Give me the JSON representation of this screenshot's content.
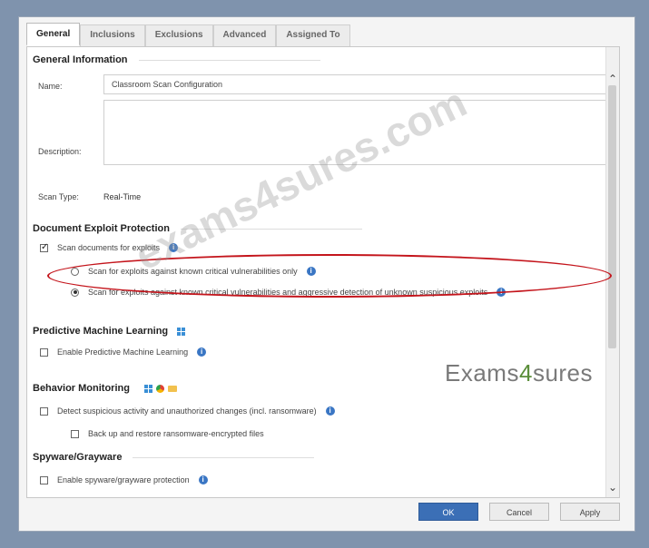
{
  "tabs": [
    "General",
    "Inclusions",
    "Exclusions",
    "Advanced",
    "Assigned To"
  ],
  "general_info": {
    "title": "General Information",
    "name_label": "Name:",
    "name_value": "Classroom Scan Configuration",
    "description_label": "Description:",
    "description_value": "",
    "scan_type_label": "Scan Type:",
    "scan_type_value": "Real-Time"
  },
  "document_exploit": {
    "title": "Document Exploit Protection",
    "scan_checkbox": "Scan documents for exploits",
    "radio_1": "Scan for exploits against known critical vulnerabilities only",
    "radio_2": "Scan for exploits against known critical vulnerabilities and aggressive detection of unknown suspicious exploits"
  },
  "predictive_ml": {
    "title": "Predictive Machine Learning",
    "checkbox": "Enable Predictive Machine Learning"
  },
  "behavior": {
    "title": "Behavior Monitoring",
    "checkbox_1": "Detect suspicious activity and unauthorized changes (incl. ransomware)",
    "checkbox_2": "Back up and restore ransomware-encrypted files"
  },
  "spyware": {
    "title": "Spyware/Grayware",
    "checkbox": "Enable spyware/grayware protection"
  },
  "buttons": {
    "ok": "OK",
    "cancel": "Cancel",
    "apply": "Apply"
  },
  "watermark": {
    "diagonal": "exams4sures.com",
    "side_a": "Exams",
    "side_num": "4",
    "side_b": "sures"
  },
  "colors": {
    "accent": "#3b6fb6",
    "highlight": "#c4151c",
    "info": "#3a76c4"
  },
  "icons": [
    "info-icon",
    "windows-icon",
    "chrome-icon",
    "folder-icon",
    "chevron-up-icon",
    "chevron-down-icon"
  ]
}
